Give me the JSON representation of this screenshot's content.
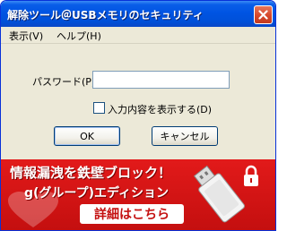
{
  "window": {
    "title": "解除ツール＠USBメモリのセキュリティ"
  },
  "menu": {
    "items": [
      "表示(V)",
      "ヘルプ(H)"
    ]
  },
  "form": {
    "password_label": "パスワード(P)",
    "password_value": "",
    "show_input_label": "入力内容を表示する(D)",
    "show_input_checked": false
  },
  "buttons": {
    "ok": "OK",
    "cancel": "キャンセル"
  },
  "banner": {
    "line1": "情報漏洩を鉄壁ブロック！",
    "line2": "g(グループ)エディション",
    "cta": "詳細はこちら"
  },
  "icons": {
    "close": "close-icon",
    "usb": "usb-stick-icon",
    "lock": "padlock-icon",
    "heart": "heart-icon"
  },
  "colors": {
    "titlebar": "#0054e3",
    "banner": "#d41414",
    "face": "#ece9d8"
  }
}
